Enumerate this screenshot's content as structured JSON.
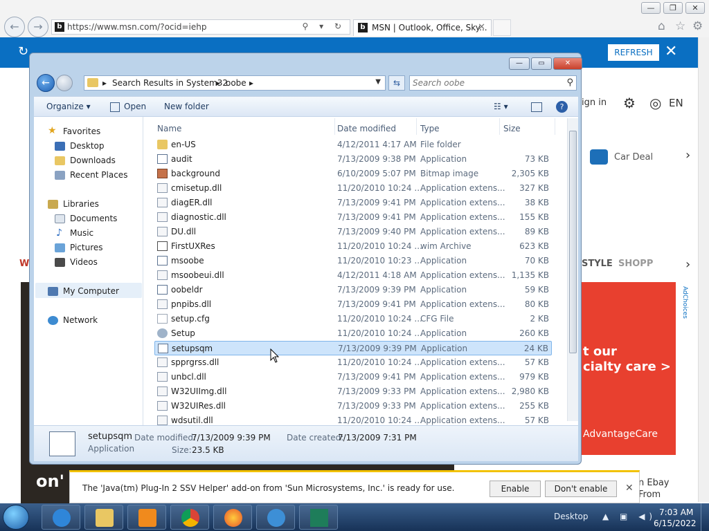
{
  "browser": {
    "url": "https://www.msn.com/?ocid=iehp",
    "tab_title": "MSN | Outlook, Office, Sky...",
    "tab_close": "✕",
    "favicon": "b",
    "addr_tools": "⚲ ▾ ↻",
    "window_buttons": [
      "—",
      "❐",
      "✕"
    ],
    "icons": [
      "home-icon",
      "star-icon",
      "gear-icon"
    ]
  },
  "msn": {
    "refresh_label": "REFRESH",
    "close_label": "✕",
    "sign_in": "ign in",
    "lang": "EN",
    "car_deals": "Car Deal",
    "style": "STYLE",
    "shopping": "SHOPP",
    "ad_line1": "t our",
    "ad_line2": "cialty care >",
    "ad_brand": "AdvantageCare",
    "ad_choices": "AdChoices",
    "bottom_text": "on'",
    "ebay_line1": "n Ebay",
    "ebay_line2": "From",
    "left_w": "W"
  },
  "explorer": {
    "caption_buttons": [
      "—",
      "▭",
      "✕"
    ],
    "breadcrumb": [
      "Search Results in System32",
      "oobe"
    ],
    "search_placeholder": "Search oobe",
    "toolbar": {
      "organize": "Organize ▾",
      "open": "Open",
      "new_folder": "New folder"
    },
    "nav": {
      "favorites": "Favorites",
      "desktop": "Desktop",
      "downloads": "Downloads",
      "recent": "Recent Places",
      "libraries": "Libraries",
      "documents": "Documents",
      "music": "Music",
      "pictures": "Pictures",
      "videos": "Videos",
      "computer": "My Computer",
      "network": "Network"
    },
    "columns": {
      "name": "Name",
      "date": "Date modified",
      "type": "Type",
      "size": "Size"
    },
    "files": [
      {
        "name": "en-US",
        "date": "4/12/2011 4:17 AM",
        "type": "File folder",
        "size": "",
        "icon": "folder"
      },
      {
        "name": "audit",
        "date": "7/13/2009 9:38 PM",
        "type": "Application",
        "size": "73 KB",
        "icon": "app"
      },
      {
        "name": "background",
        "date": "6/10/2009 5:07 PM",
        "type": "Bitmap image",
        "size": "2,305 KB",
        "icon": "bmp"
      },
      {
        "name": "cmisetup.dll",
        "date": "11/20/2010 10:24 ...",
        "type": "Application extens...",
        "size": "327 KB",
        "icon": "dll"
      },
      {
        "name": "diagER.dll",
        "date": "7/13/2009 9:41 PM",
        "type": "Application extens...",
        "size": "38 KB",
        "icon": "dll"
      },
      {
        "name": "diagnostic.dll",
        "date": "7/13/2009 9:41 PM",
        "type": "Application extens...",
        "size": "155 KB",
        "icon": "dll"
      },
      {
        "name": "DU.dll",
        "date": "7/13/2009 9:40 PM",
        "type": "Application extens...",
        "size": "89 KB",
        "icon": "dll"
      },
      {
        "name": "FirstUXRes",
        "date": "11/20/2010 10:24 ...",
        "type": "wim Archive",
        "size": "623 KB",
        "icon": "wim"
      },
      {
        "name": "msoobe",
        "date": "11/20/2010 10:23 ...",
        "type": "Application",
        "size": "70 KB",
        "icon": "app"
      },
      {
        "name": "msoobeui.dll",
        "date": "4/12/2011 4:18 AM",
        "type": "Application extens...",
        "size": "1,135 KB",
        "icon": "dll"
      },
      {
        "name": "oobeldr",
        "date": "7/13/2009 9:39 PM",
        "type": "Application",
        "size": "59 KB",
        "icon": "app"
      },
      {
        "name": "pnpibs.dll",
        "date": "7/13/2009 9:41 PM",
        "type": "Application extens...",
        "size": "80 KB",
        "icon": "dll"
      },
      {
        "name": "setup.cfg",
        "date": "11/20/2010 10:24 ...",
        "type": "CFG File",
        "size": "2 KB",
        "icon": "file"
      },
      {
        "name": "Setup",
        "date": "11/20/2010 10:24 ...",
        "type": "Application",
        "size": "260 KB",
        "icon": "setup"
      },
      {
        "name": "setupsqm",
        "date": "7/13/2009 9:39 PM",
        "type": "Application",
        "size": "24 KB",
        "icon": "app",
        "selected": true
      },
      {
        "name": "spprgrss.dll",
        "date": "11/20/2010 10:24 ...",
        "type": "Application extens...",
        "size": "57 KB",
        "icon": "dll"
      },
      {
        "name": "unbcl.dll",
        "date": "7/13/2009 9:41 PM",
        "type": "Application extens...",
        "size": "979 KB",
        "icon": "dll"
      },
      {
        "name": "W32UIImg.dll",
        "date": "7/13/2009 9:33 PM",
        "type": "Application extens...",
        "size": "2,980 KB",
        "icon": "dll"
      },
      {
        "name": "W32UIRes.dll",
        "date": "7/13/2009 9:33 PM",
        "type": "Application extens...",
        "size": "255 KB",
        "icon": "dll"
      },
      {
        "name": "wdsutil.dll",
        "date": "11/20/2010 10:24 ...",
        "type": "Application extens...",
        "size": "57 KB",
        "icon": "dll"
      }
    ],
    "details": {
      "name": "setupsqm",
      "kind": "Application",
      "modified_label": "Date modified:",
      "modified_value": "7/13/2009 9:39 PM",
      "created_label": "Date created:",
      "created_value": "7/13/2009 7:31 PM",
      "size_label": "Size:",
      "size_value": "23.5 KB"
    }
  },
  "notification": {
    "message": "The 'Java(tm) Plug-In 2 SSV Helper' add-on from 'Sun Microsystems, Inc.' is ready for use.",
    "enable": "Enable",
    "dont_enable": "Don't enable",
    "close": "✕"
  },
  "taskbar": {
    "desktop_label": "Desktop",
    "tray": "▲ ▣ ◀)",
    "time": "7:03 AM",
    "date": "6/15/2022",
    "apps": [
      "internet-explorer",
      "file-explorer",
      "media-player",
      "chrome",
      "firefox",
      "ie-tool",
      "network-tool"
    ]
  }
}
